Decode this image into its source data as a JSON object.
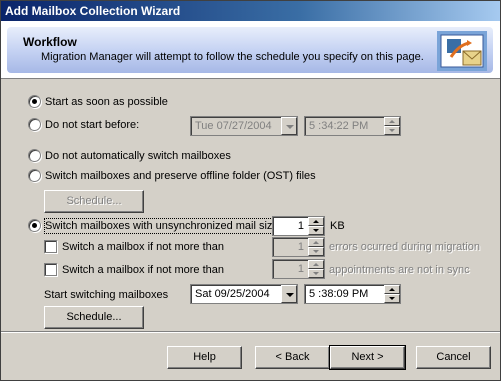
{
  "window": {
    "title": "Add Mailbox Collection Wizard"
  },
  "header": {
    "title": "Workflow",
    "description": "Migration Manager will attempt to follow the schedule you specify on this page."
  },
  "options": {
    "start_asap": "Start as soon as possible",
    "do_not_start_before": "Do not start before:",
    "no_auto_switch": "Do not automatically switch mailboxes",
    "switch_preserve_ost": "Switch mailboxes and preserve offline folder (OST) files",
    "switch_unsync": "Switch mailboxes with unsynchronized mail size:",
    "kb_unit": "KB",
    "switch_if_errors": "Switch a mailbox if not more than",
    "errors_suffix": "errors ocurred during migration",
    "switch_if_appointments": "Switch a mailbox if not more than",
    "appointments_suffix": "appointments are not in sync",
    "start_switching": "Start switching mailboxes"
  },
  "fields": {
    "not_before_date": "Tue  07/27/2004",
    "not_before_time": "5 :34:22 PM",
    "unsync_size": "1",
    "errors_count": "1",
    "appointments_count": "1",
    "switch_date": "Sat  09/25/2004",
    "switch_time": "5 :38:09 PM"
  },
  "buttons": {
    "schedule_disabled": "Schedule...",
    "schedule": "Schedule...",
    "help": "Help",
    "back": "< Back",
    "next": "Next >",
    "cancel": "Cancel"
  },
  "state": {
    "selected_start": "start_asap",
    "selected_switch": "switch_unsync"
  },
  "icons": {
    "header_logo": "mailbox-envelope-icon"
  }
}
